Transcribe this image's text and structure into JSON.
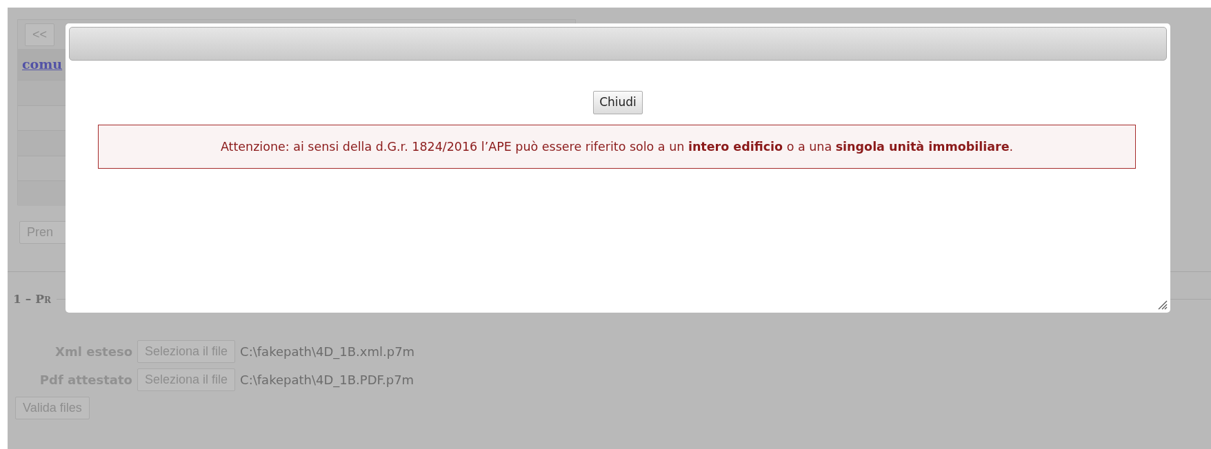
{
  "page": {
    "pager": {
      "first_button": "<<"
    },
    "table": {
      "header_link": "comu"
    },
    "partial_button": "Pren",
    "section_title": "1 – Pr",
    "files": [
      {
        "label": "Xml esteso",
        "button": "Seleziona il file",
        "value": "C:\\fakepath\\4D_1B.xml.p7m"
      },
      {
        "label": "Pdf attestato",
        "button": "Seleziona il file",
        "value": "C:\\fakepath\\4D_1B.PDF.p7m"
      }
    ],
    "validate_button": "Valida files"
  },
  "dialog": {
    "close_button": "Chiudi",
    "alert": "Attenzione: ai sensi della d.G.r. 1824/2016 l’APE può essere riferito solo a un **intero edificio** o a una **singola unità immobiliare**."
  }
}
